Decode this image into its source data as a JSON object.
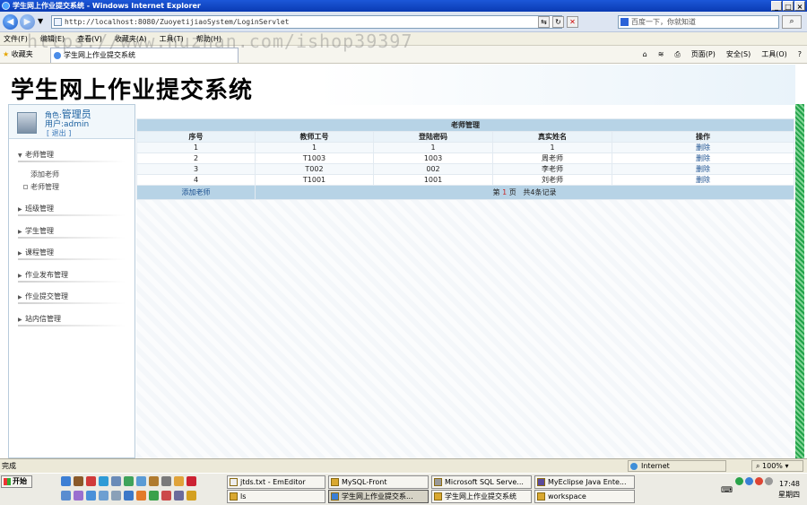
{
  "window": {
    "title": "学生网上作业提交系统 - Windows Internet Explorer",
    "controls": [
      "_",
      "□",
      "×"
    ]
  },
  "address_bar": {
    "url": "http://localhost:8080/ZuoyetijiaoSystem/LoginServlet",
    "search_placeholder": "百度一下，你就知道"
  },
  "menu_bar": [
    "文件(F)",
    "编辑(E)",
    "查看(V)",
    "收藏夹(A)",
    "工具(T)",
    "帮助(H)"
  ],
  "favorites_bar": {
    "favorites_label": "收藏夹",
    "tab_title": "学生网上作业提交系统",
    "commands": [
      "页面(P)",
      "安全(S)",
      "工具(O)"
    ]
  },
  "watermark": "https://www.huzhan.com/ishop39397",
  "site": {
    "title": "学生网上作业提交系统"
  },
  "user_panel": {
    "role_label": "角色:",
    "role_value": "管理员",
    "user_label": "用户:",
    "user_value": "admin",
    "logout": "[ 退出 ]"
  },
  "sidebar_menu": [
    {
      "label": "老师管理",
      "expanded": true,
      "children": [
        "添加老师",
        "老师管理"
      ]
    },
    {
      "label": "班级管理"
    },
    {
      "label": "学生管理"
    },
    {
      "label": "课程管理"
    },
    {
      "label": "作业发布管理"
    },
    {
      "label": "作业提交管理"
    },
    {
      "label": "站内信管理"
    }
  ],
  "teacher_table": {
    "caption": "老师管理",
    "columns": [
      "序号",
      "教师工号",
      "登陆密码",
      "真实姓名",
      "操作"
    ],
    "rows": [
      [
        "1",
        "1",
        "1",
        "1",
        "删除"
      ],
      [
        "2",
        "T1003",
        "1003",
        "周老师",
        "删除"
      ],
      [
        "3",
        "T002",
        "002",
        "李老师",
        "删除"
      ],
      [
        "4",
        "T1001",
        "1001",
        "刘老师",
        "删除"
      ]
    ],
    "footer": {
      "add_link": "添加老师",
      "page_prefix": "第",
      "page_number": "1",
      "page_suffix": "页",
      "total": "共4条记录"
    }
  },
  "status_bar": {
    "text": "完成",
    "zone": "Internet",
    "zoom": "100%"
  },
  "taskbar": {
    "start": "开始",
    "tasks_row1": [
      "jtds.txt - EmEditor",
      "MySQL-Front",
      "Microsoft SQL Serve...",
      "MyEclipse Java Ente..."
    ],
    "tasks_row2": [
      "ls",
      "学生网上作业提交系...",
      "学生网上作业提交系统",
      "workspace"
    ],
    "clock_time": "17:48",
    "clock_day": "星期四"
  },
  "colors": {
    "titlebar": "#0a3bb3",
    "table_header": "#b7d3e6",
    "link": "#1a4f8f",
    "role_text": "#1a5f9f",
    "right_bar": "#22a34a"
  }
}
